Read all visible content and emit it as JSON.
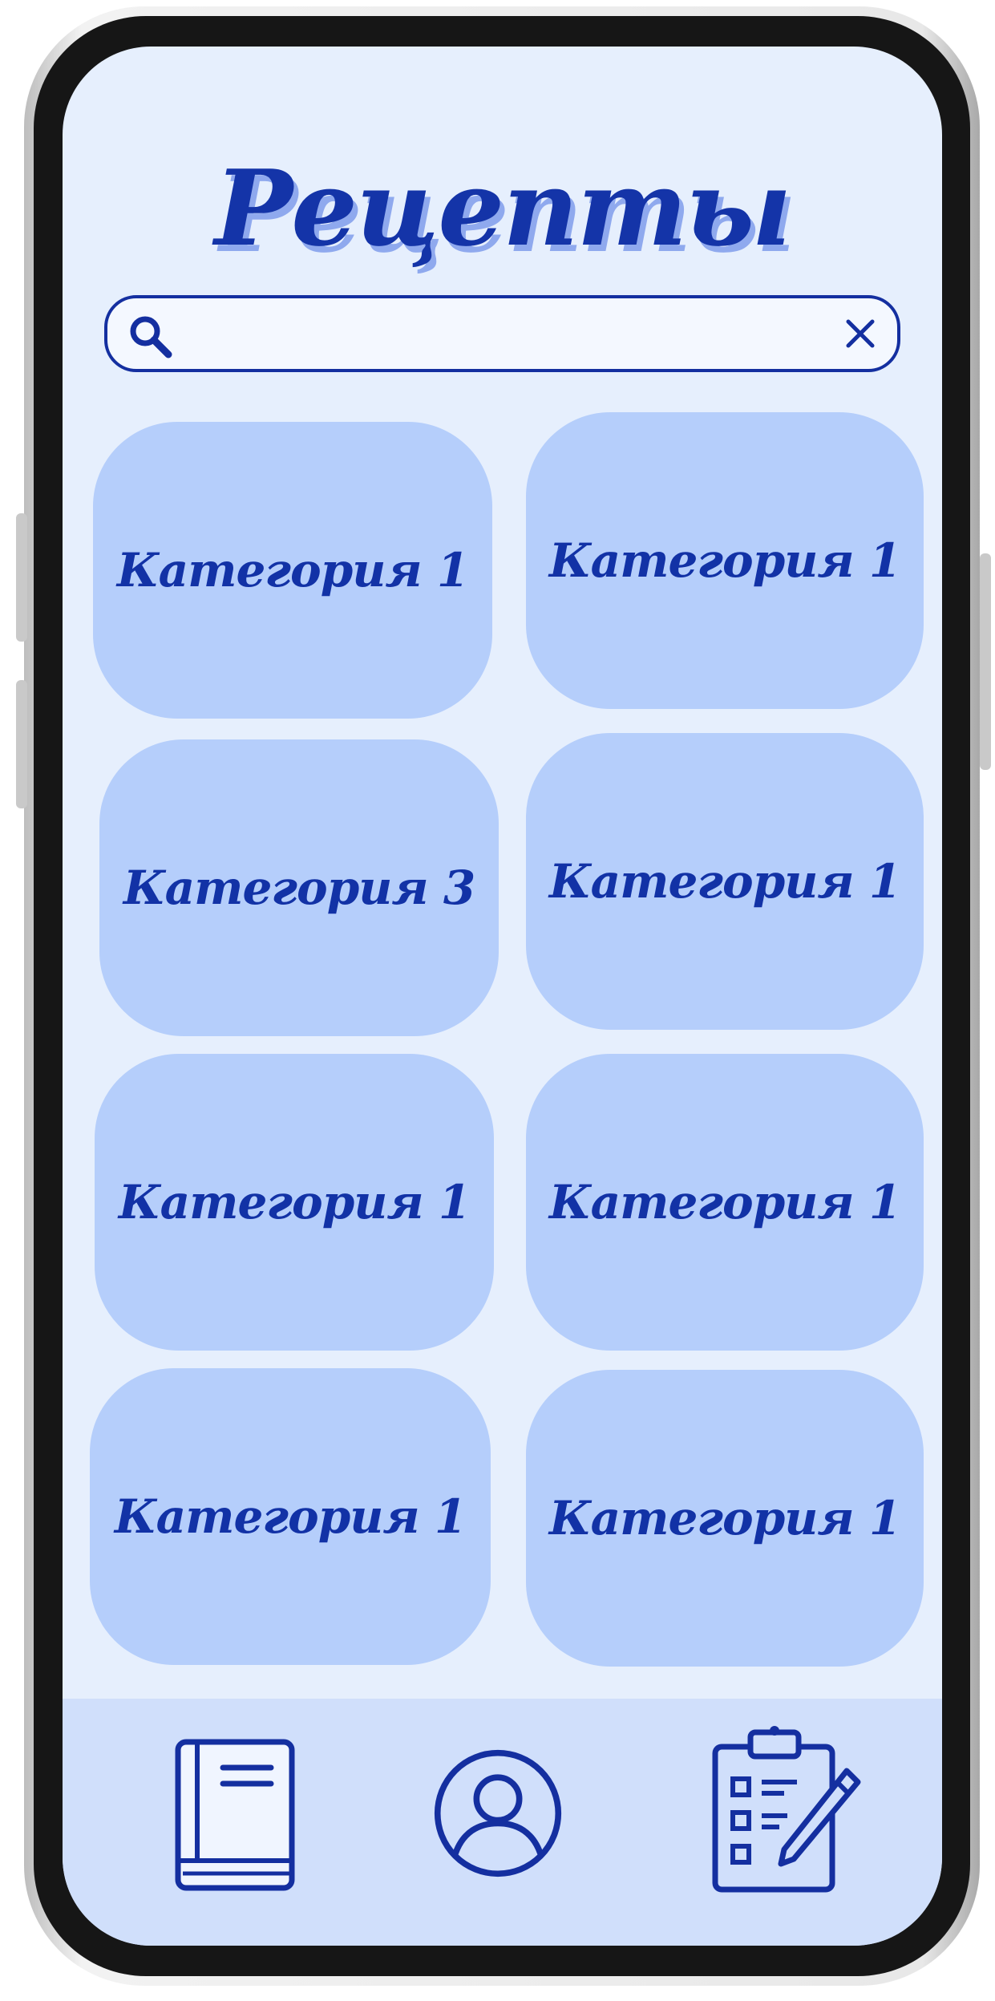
{
  "app": {
    "title": "Рецепты"
  },
  "search": {
    "value": "",
    "placeholder": ""
  },
  "categories": [
    {
      "label": "Категория 1"
    },
    {
      "label": "Категория 1"
    },
    {
      "label": "Категория 3"
    },
    {
      "label": "Категория 1"
    },
    {
      "label": "Категория 1"
    },
    {
      "label": "Категория 1"
    },
    {
      "label": "Категория 1"
    },
    {
      "label": "Категория 1"
    }
  ],
  "bottom_nav": {
    "items": [
      {
        "icon": "book-icon"
      },
      {
        "icon": "profile-icon"
      },
      {
        "icon": "clipboard-checklist-icon"
      }
    ]
  },
  "colors": {
    "accent": "#1434a8",
    "card": "#b5cefb",
    "screen_bg": "#e6effd",
    "nav_bg": "#d0dffb"
  }
}
